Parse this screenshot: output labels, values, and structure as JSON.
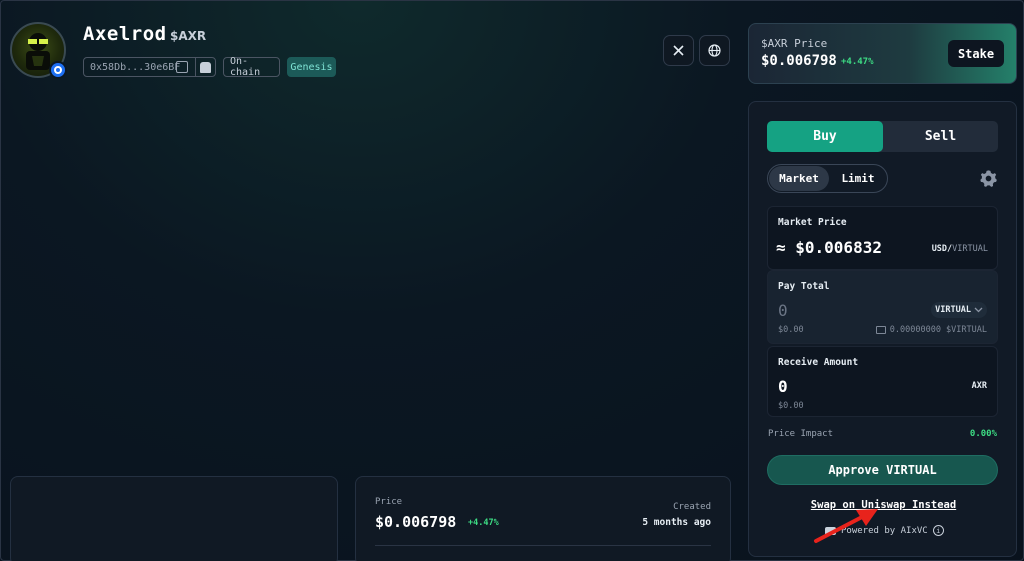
{
  "token": {
    "name": "Axelrod",
    "ticker": "$AXR",
    "address": "0x58Db...30e6BF",
    "tags": [
      "On-chain",
      "Genesis"
    ]
  },
  "header_icons": [
    "x-logo-icon",
    "globe-icon"
  ],
  "price_card": {
    "label": "$AXR Price",
    "value": "$0.006798",
    "change": "+4.47%",
    "stake_label": "Stake"
  },
  "trade": {
    "buy_label": "Buy",
    "sell_label": "Sell",
    "market_label": "Market",
    "limit_label": "Limit",
    "market_price": {
      "label": "Market Price",
      "value": "≈ $0.006832",
      "unit_main": "USD/",
      "unit_sub": "VIRTUAL"
    },
    "pay": {
      "label": "Pay Total",
      "value": "0",
      "token": "VIRTUAL",
      "usd": "$0.00",
      "balance": "0.00000000 $VIRTUAL"
    },
    "receive": {
      "label": "Receive Amount",
      "value": "0",
      "token": "AXR",
      "usd": "$0.00"
    },
    "price_impact_label": "Price Impact",
    "price_impact_value": "0.00%",
    "approve_label": "Approve VIRTUAL",
    "uniswap_link": "Swap on Uniswap Instead",
    "powered_by": "Powered by AIxVC"
  },
  "stats_card": {
    "price_label": "Price",
    "price_value": "$0.006798",
    "price_change": "+4.47%",
    "created_label": "Created",
    "created_value": "5 months ago"
  },
  "colors": {
    "accent": "#15a283",
    "positive": "#3ddc84",
    "background": "#09121d"
  }
}
